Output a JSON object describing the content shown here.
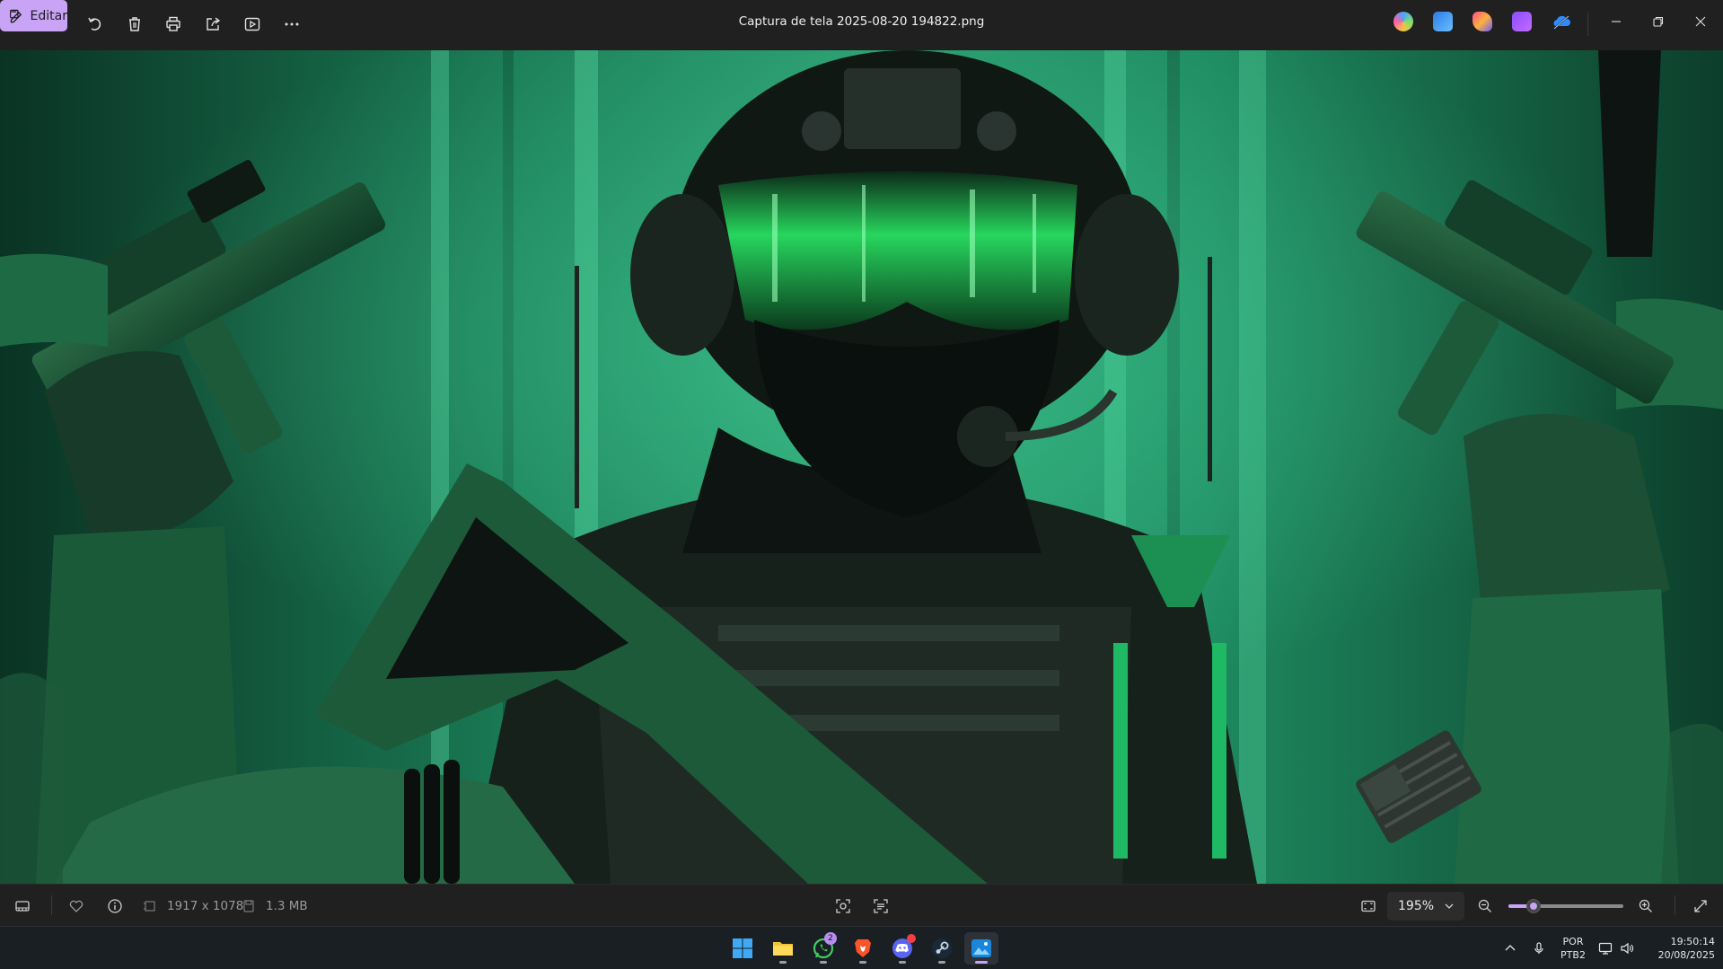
{
  "toolbar": {
    "edit_label": "Editar",
    "file_title": "Captura de tela 2025-08-20 194822.png"
  },
  "image": {
    "description_icon": "soldier-artwork",
    "accent_color": "#2fd47a"
  },
  "bottom_bar": {
    "dimensions": "1917 x 1078",
    "file_size": "1.3 MB",
    "zoom_label": "195%",
    "zoom_fraction": 0.22
  },
  "taskbar": {
    "whatsapp_badge": "2",
    "language_top": "POR",
    "language_bottom": "PTB2",
    "time": "19:50:14",
    "date": "20/08/2025"
  },
  "colors": {
    "accent": "#c9a3f5",
    "titlebar": "#202020",
    "taskbar": "#1a1f24"
  }
}
